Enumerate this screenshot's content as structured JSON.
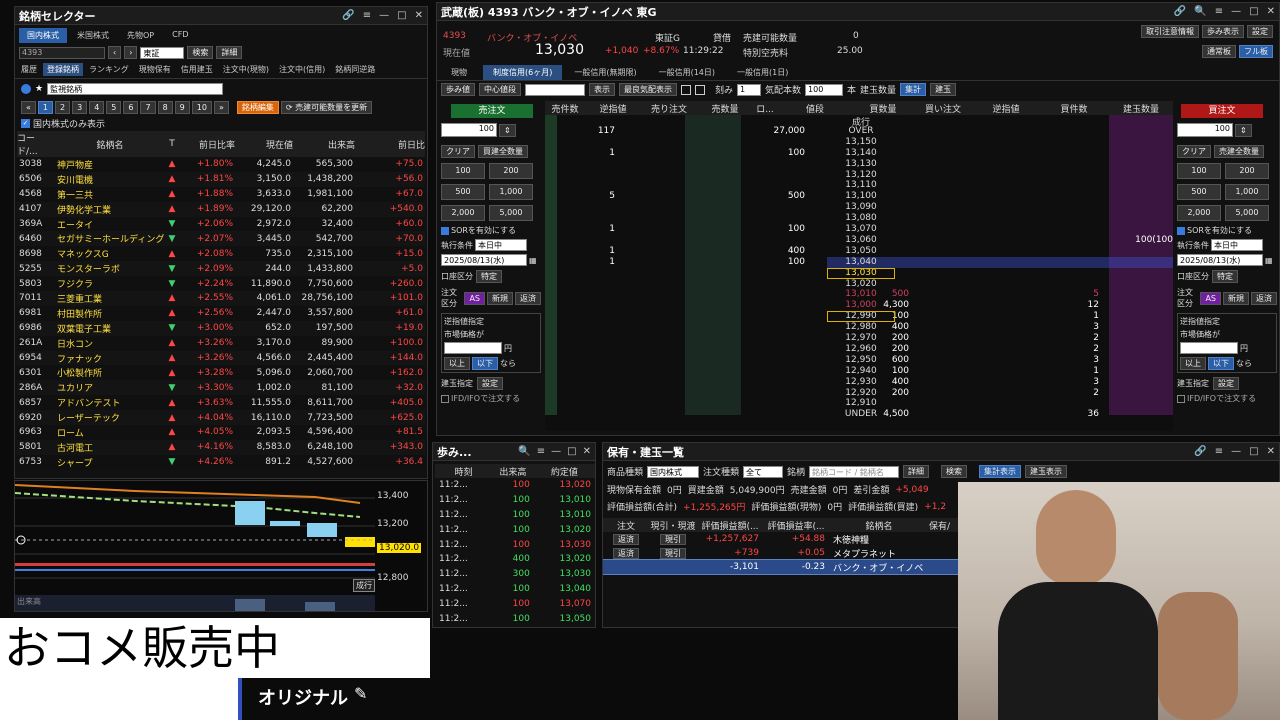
{
  "stock_selector": {
    "title": "銘柄セレクター",
    "tabs": [
      "国内株式",
      "米国株式",
      "先物OP",
      "CFD"
    ],
    "code_input": "4393",
    "market": "東証",
    "search_btn": "検索",
    "detail_btn": "詳細",
    "subtabs": [
      "履歴",
      "登録銘柄",
      "ランキング",
      "現物保有",
      "信用建玉",
      "注文中(現物)",
      "注文中(信用)",
      "銘柄同逆路"
    ],
    "list_name": "監視銘柄",
    "pages": [
      "1",
      "2",
      "3",
      "4",
      "5",
      "6",
      "7",
      "8",
      "9",
      "10"
    ],
    "edit_btn": "銘柄編集",
    "update_btn": "売建可能数量を更新",
    "domestic_only": "国内株式のみ表示",
    "headers": [
      "コード/...",
      "銘柄名",
      "T",
      "前日比率",
      "現在値",
      "出来高",
      "前日比"
    ],
    "rows": [
      {
        "code": "3038",
        "name": "神戸物産",
        "dir": "up",
        "pct": "+1.80%",
        "price": "4,245.0",
        "vol": "565,300",
        "chg": "+75.0"
      },
      {
        "code": "6506",
        "name": "安川電機",
        "dir": "up",
        "pct": "+1.81%",
        "price": "3,150.0",
        "vol": "1,438,200",
        "chg": "+56.0"
      },
      {
        "code": "4568",
        "name": "第一三共",
        "dir": "up",
        "pct": "+1.88%",
        "price": "3,633.0",
        "vol": "1,981,100",
        "chg": "+67.0"
      },
      {
        "code": "4107",
        "name": "伊勢化学工業",
        "dir": "up",
        "pct": "+1.89%",
        "price": "29,120.0",
        "vol": "62,200",
        "chg": "+540.0"
      },
      {
        "code": "369A",
        "name": "エータイ",
        "dir": "dn",
        "pct": "+2.06%",
        "price": "2,972.0",
        "vol": "32,400",
        "chg": "+60.0"
      },
      {
        "code": "6460",
        "name": "セガサミーホールディングス",
        "dir": "dn",
        "pct": "+2.07%",
        "price": "3,445.0",
        "vol": "542,700",
        "chg": "+70.0"
      },
      {
        "code": "8698",
        "name": "マネックスG",
        "dir": "up",
        "pct": "+2.08%",
        "price": "735.0",
        "vol": "2,315,100",
        "chg": "+15.0"
      },
      {
        "code": "5255",
        "name": "モンスターラボ",
        "dir": "dn",
        "pct": "+2.09%",
        "price": "244.0",
        "vol": "1,433,800",
        "chg": "+5.0"
      },
      {
        "code": "5803",
        "name": "フジクラ",
        "dir": "dn",
        "pct": "+2.24%",
        "price": "11,890.0",
        "vol": "7,750,600",
        "chg": "+260.0"
      },
      {
        "code": "7011",
        "name": "三菱重工業",
        "dir": "up",
        "pct": "+2.55%",
        "price": "4,061.0",
        "vol": "28,756,100",
        "chg": "+101.0"
      },
      {
        "code": "6981",
        "name": "村田製作所",
        "dir": "up",
        "pct": "+2.56%",
        "price": "2,447.0",
        "vol": "3,557,800",
        "chg": "+61.0"
      },
      {
        "code": "6986",
        "name": "双葉電子工業",
        "dir": "dn",
        "pct": "+3.00%",
        "price": "652.0",
        "vol": "197,500",
        "chg": "+19.0"
      },
      {
        "code": "261A",
        "name": "日水コン",
        "dir": "up",
        "pct": "+3.26%",
        "price": "3,170.0",
        "vol": "89,900",
        "chg": "+100.0"
      },
      {
        "code": "6954",
        "name": "ファナック",
        "dir": "up",
        "pct": "+3.26%",
        "price": "4,566.0",
        "vol": "2,445,400",
        "chg": "+144.0"
      },
      {
        "code": "6301",
        "name": "小松製作所",
        "dir": "up",
        "pct": "+3.28%",
        "price": "5,096.0",
        "vol": "2,060,700",
        "chg": "+162.0"
      },
      {
        "code": "286A",
        "name": "ユカリア",
        "dir": "dn",
        "pct": "+3.30%",
        "price": "1,002.0",
        "vol": "81,100",
        "chg": "+32.0"
      },
      {
        "code": "6857",
        "name": "アドバンテスト",
        "dir": "up",
        "pct": "+3.63%",
        "price": "11,555.0",
        "vol": "8,611,700",
        "chg": "+405.0"
      },
      {
        "code": "6920",
        "name": "レーザーテック",
        "dir": "up",
        "pct": "+4.04%",
        "price": "16,110.0",
        "vol": "7,723,500",
        "chg": "+625.0"
      },
      {
        "code": "6963",
        "name": "ローム",
        "dir": "up",
        "pct": "+4.05%",
        "price": "2,093.5",
        "vol": "4,596,400",
        "chg": "+81.5"
      },
      {
        "code": "5801",
        "name": "古河電工",
        "dir": "up",
        "pct": "+4.16%",
        "price": "8,583.0",
        "vol": "6,248,100",
        "chg": "+343.0"
      },
      {
        "code": "6753",
        "name": "シャープ",
        "dir": "dn",
        "pct": "+4.26%",
        "price": "891.2",
        "vol": "4,527,600",
        "chg": "+36.4"
      }
    ]
  },
  "chart": {
    "y_labels": [
      "13,400",
      "13,200",
      "13,020.0",
      "12,800"
    ],
    "volume_label": "出来高",
    "badge": "成行"
  },
  "board": {
    "title": "武蔵(板) 4393 バンク・オブ・イノベ 東G",
    "code": "4393",
    "name": "バンク・オブ・イノベ",
    "price_label": "現在値",
    "price": "13,030",
    "change": "+1,040",
    "change_pct": "+8.67%",
    "time": "11:29:22",
    "market": "東証G",
    "lending": "貸借",
    "sellable_label": "売建可能数量",
    "sellable": "0",
    "special_label": "特別空売料",
    "special": "25.00",
    "top_buttons": [
      "取引注意情報",
      "歩み表示",
      "設定"
    ],
    "mode_buttons": [
      "通常板",
      "フル板"
    ],
    "tabs": [
      "現物",
      "制度信用(6ヶ月)",
      "一般信用(無期限)",
      "一般信用(14日)",
      "一般信用(1日)"
    ],
    "toolbar": {
      "ayumi": "歩み値",
      "center": "中心値段",
      "show": "表示",
      "best": "最良気配表示",
      "tick_label": "刻み",
      "tick": "1",
      "qty_label": "気配本数",
      "qty": "100",
      "unit": "本",
      "pos_label": "建玉数量",
      "sum_btn": "集計",
      "pos_btn": "建玉"
    },
    "sell_order": "売注文",
    "buy_order": "買注文",
    "headers": [
      "売件数",
      "逆指値",
      "売り注文",
      "売数量",
      "ロ...",
      "値段",
      "買数量",
      "買い注文",
      "逆指値",
      "買件数",
      "建玉数量"
    ],
    "ladder": [
      {
        "sc": "",
        "sq": "",
        "price": "成行",
        "bq": "",
        "bc": ""
      },
      {
        "sc": "117",
        "sq": "27,000",
        "price": "OVER",
        "bq": "",
        "bc": ""
      },
      {
        "sc": "",
        "sq": "",
        "price": "13,150",
        "bq": "",
        "bc": ""
      },
      {
        "sc": "1",
        "sq": "100",
        "price": "13,140",
        "bq": "",
        "bc": ""
      },
      {
        "sc": "",
        "sq": "",
        "price": "13,130",
        "bq": "",
        "bc": ""
      },
      {
        "sc": "",
        "sq": "",
        "price": "13,120",
        "bq": "",
        "bc": ""
      },
      {
        "sc": "",
        "sq": "",
        "price": "13,110",
        "bq": "",
        "bc": ""
      },
      {
        "sc": "5",
        "sq": "500",
        "price": "13,100",
        "bq": "",
        "bc": ""
      },
      {
        "sc": "",
        "sq": "",
        "price": "13,090",
        "bq": "",
        "bc": ""
      },
      {
        "sc": "",
        "sq": "",
        "price": "13,080",
        "bq": "",
        "bc": ""
      },
      {
        "sc": "1",
        "sq": "100",
        "price": "13,070",
        "bq": "",
        "bc": ""
      },
      {
        "sc": "",
        "sq": "",
        "price": "13,060",
        "bq": "",
        "bc": "",
        "pos": "100(100"
      },
      {
        "sc": "1",
        "sq": "400",
        "price": "13,050",
        "bq": "",
        "bc": ""
      },
      {
        "sc": "1",
        "sq": "100",
        "price": "13,040",
        "bq": "",
        "bc": ""
      },
      {
        "sc": "",
        "sq": "",
        "price": "13,030",
        "bq": "",
        "bc": ""
      },
      {
        "sc": "",
        "sq": "",
        "price": "13,020",
        "bq": "",
        "bc": ""
      },
      {
        "sc": "",
        "sq": "",
        "price": "13,010",
        "bq": "500",
        "bc": "5"
      },
      {
        "sc": "",
        "sq": "",
        "price": "13,000",
        "bq": "4,300",
        "bc": "12"
      },
      {
        "sc": "",
        "sq": "",
        "price": "12,990",
        "bq": "100",
        "bc": "1"
      },
      {
        "sc": "",
        "sq": "",
        "price": "12,980",
        "bq": "400",
        "bc": "3"
      },
      {
        "sc": "",
        "sq": "",
        "price": "12,970",
        "bq": "200",
        "bc": "2"
      },
      {
        "sc": "",
        "sq": "",
        "price": "12,960",
        "bq": "200",
        "bc": "2"
      },
      {
        "sc": "",
        "sq": "",
        "price": "12,950",
        "bq": "600",
        "bc": "3"
      },
      {
        "sc": "",
        "sq": "",
        "price": "12,940",
        "bq": "100",
        "bc": "1"
      },
      {
        "sc": "",
        "sq": "",
        "price": "12,930",
        "bq": "400",
        "bc": "3"
      },
      {
        "sc": "",
        "sq": "",
        "price": "12,920",
        "bq": "200",
        "bc": "2"
      },
      {
        "sc": "",
        "sq": "",
        "price": "12,910",
        "bq": "",
        "bc": ""
      },
      {
        "sc": "",
        "sq": "",
        "price": "UNDER",
        "bq": "4,500",
        "bc": "36"
      }
    ],
    "order_panel": {
      "qty": "100",
      "clear": "クリア",
      "all_buy": "買建全数量",
      "all_sell": "売建全数量",
      "amounts": [
        "100",
        "200",
        "500",
        "1,000",
        "2,000",
        "5,000"
      ],
      "sor": "SORを有効にする",
      "cond_label": "執行条件",
      "cond": "本日中",
      "date": "2025/08/13(水)",
      "account_label": "口座区分",
      "account": "特定",
      "order_type_label": "注文区分",
      "order_types": [
        "AS",
        "新規",
        "返済"
      ],
      "stop_label": "逆指値指定",
      "market_price": "市場価格が",
      "yen": "円",
      "above": "以上",
      "below": "以下",
      "then": "なら",
      "pos_label": "建玉指定",
      "pos_btn": "設定",
      "ifd": "IFD/IFOで注文する"
    }
  },
  "ayumi": {
    "title": "歩み...",
    "headers": [
      "時刻",
      "出来高",
      "約定値"
    ],
    "rows": [
      {
        "t": "11:2...",
        "v": "100",
        "p": "13,020",
        "c": "up"
      },
      {
        "t": "11:2...",
        "v": "100",
        "p": "13,010",
        "c": "dn"
      },
      {
        "t": "11:2...",
        "v": "100",
        "p": "13,010",
        "c": "dn"
      },
      {
        "t": "11:2...",
        "v": "100",
        "p": "13,020",
        "c": "dn"
      },
      {
        "t": "11:2...",
        "v": "100",
        "p": "13,030",
        "c": "up"
      },
      {
        "t": "11:2...",
        "v": "400",
        "p": "13,020",
        "c": "dn"
      },
      {
        "t": "11:2...",
        "v": "300",
        "p": "13,030",
        "c": "dn"
      },
      {
        "t": "11:2...",
        "v": "100",
        "p": "13,040",
        "c": "dn"
      },
      {
        "t": "11:2...",
        "v": "100",
        "p": "13,070",
        "c": "up"
      },
      {
        "t": "11:2...",
        "v": "100",
        "p": "13,050",
        "c": "dn"
      }
    ]
  },
  "holdings": {
    "title": "保有・建玉一覧",
    "product_label": "商品種類",
    "product": "国内株式",
    "order_type_label": "注文種類",
    "order_type": "全て",
    "stock_label": "銘柄",
    "stock_placeholder": "銘柄コード / 銘柄名",
    "detail": "詳細",
    "search": "検索",
    "sum_btn": "集計表示",
    "pos_btn": "建玉表示",
    "summary1": [
      {
        "label": "現物保有金額",
        "value": "0円"
      },
      {
        "label": "買建金額",
        "value": "5,049,900円"
      },
      {
        "label": "売建金額",
        "value": "0円"
      },
      {
        "label": "差引金額",
        "value": "+5,049"
      }
    ],
    "summary2": [
      {
        "label": "評価損益額(合計)",
        "value": "+1,255,265円"
      },
      {
        "label": "評価損益額(現物)",
        "value": "0円"
      },
      {
        "label": "評価損益額(買建)",
        "value": "+1,2"
      }
    ],
    "headers": [
      "注文",
      "現引・現渡",
      "評価損益額(...",
      "評価損益率(...",
      "銘柄名",
      "保有/"
    ],
    "rows": [
      {
        "order": "返済",
        "act": "現引",
        "pl": "+1,257,627",
        "rate": "+54.88",
        "name": "木徳神糧",
        "cls": "up"
      },
      {
        "order": "返済",
        "act": "現引",
        "pl": "+739",
        "rate": "+0.05",
        "name": "メタプラネット",
        "cls": "up"
      },
      {
        "order": "",
        "act": "",
        "pl": "-3,101",
        "rate": "-0.23",
        "name": "バンク・オブ・イノベ",
        "cls": "dn"
      }
    ]
  },
  "overlay": {
    "banner": "おコメ販売中",
    "tag": "オリジナル"
  }
}
